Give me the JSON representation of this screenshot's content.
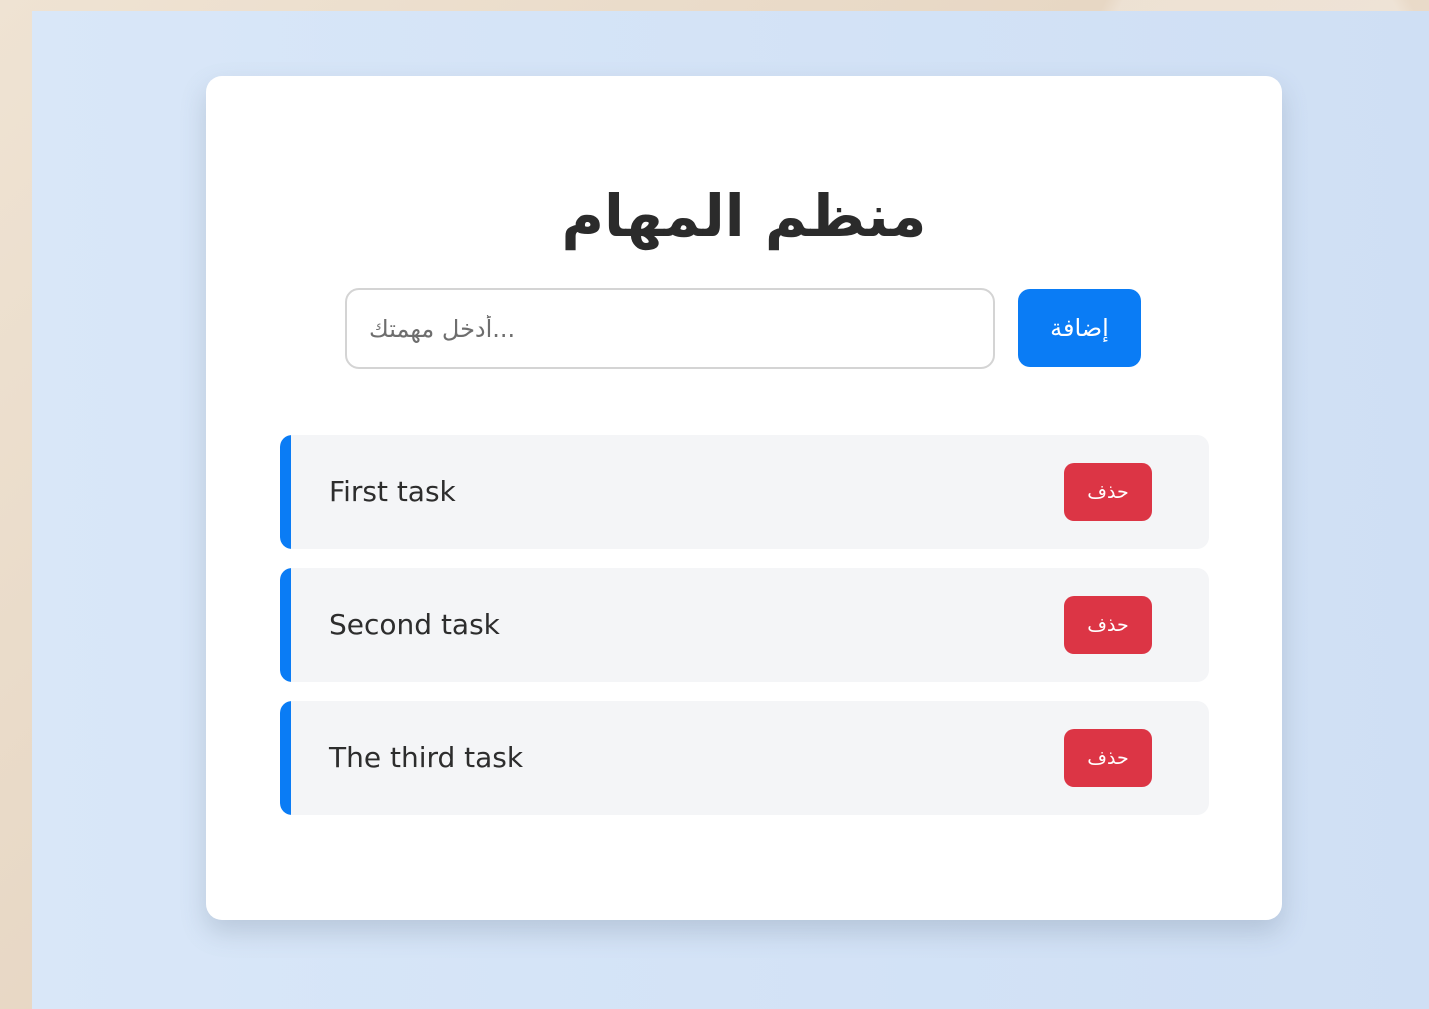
{
  "app": {
    "title": "منظم المهام"
  },
  "input": {
    "placeholder": "...أدخل مهمتك",
    "value": ""
  },
  "buttons": {
    "add_label": "إضافة",
    "delete_label": "حذف"
  },
  "tasks": [
    {
      "text": "First task"
    },
    {
      "text": "Second task"
    },
    {
      "text": "The third task"
    }
  ],
  "colors": {
    "background": "#d6e5f7",
    "card": "#ffffff",
    "primary": "#0a7cf5",
    "danger": "#dc3545",
    "task_background": "#f4f5f7",
    "text": "#2d2d2d"
  },
  "icons": {
    "add": "none",
    "delete": "none"
  }
}
